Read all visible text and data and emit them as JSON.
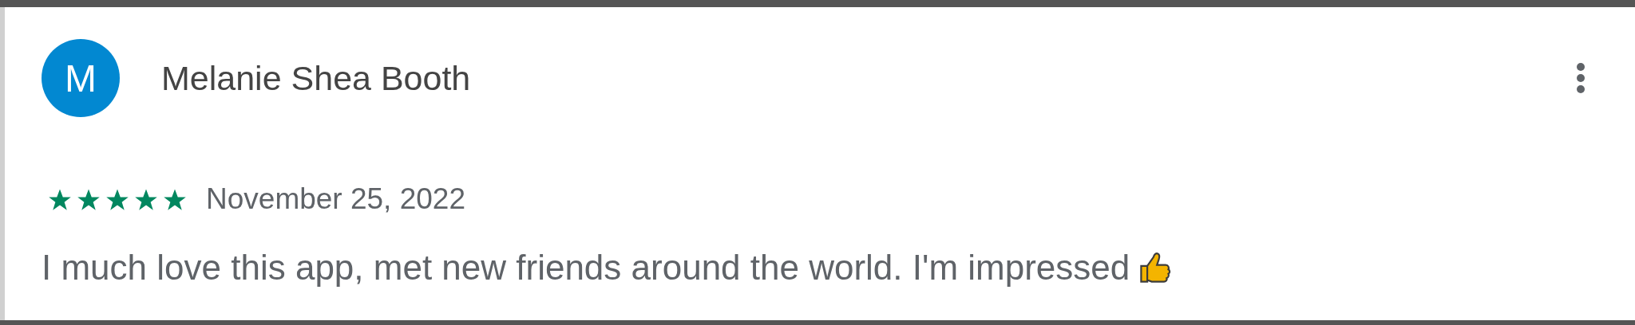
{
  "review": {
    "avatar_letter": "M",
    "author": "Melanie Shea Booth",
    "stars": 5,
    "date": "November 25, 2022",
    "text": "I much love this app, met new friends around the world. I'm impressed"
  }
}
